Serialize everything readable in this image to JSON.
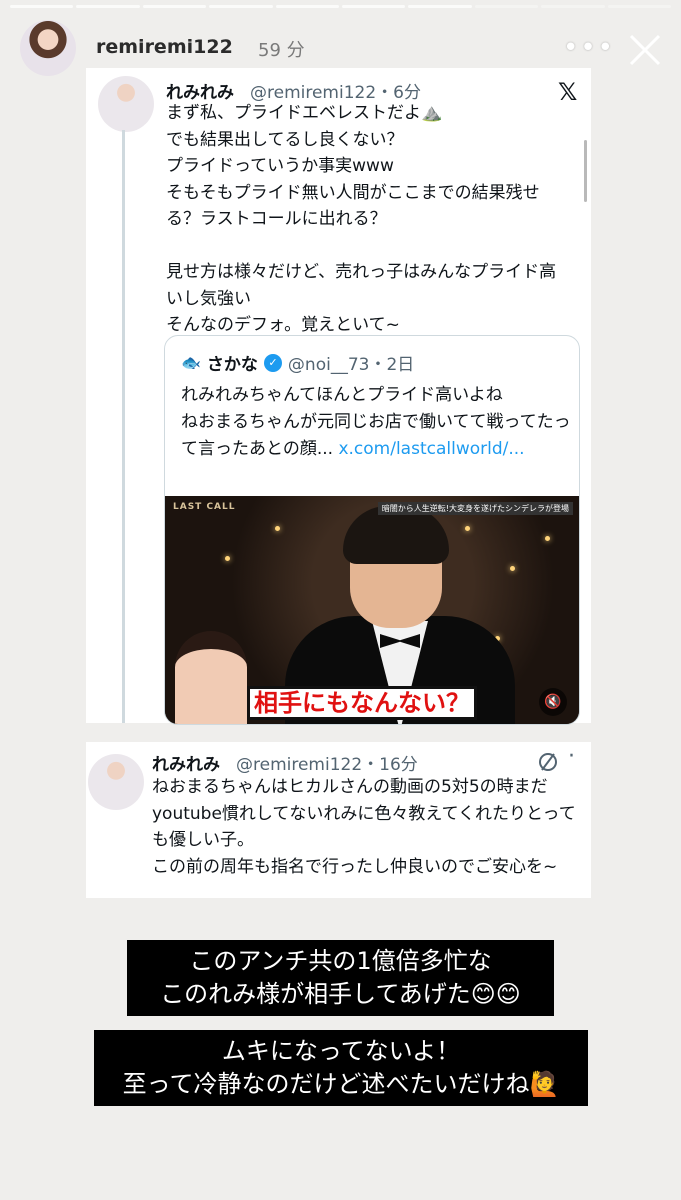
{
  "story": {
    "username": "remiremi122",
    "time": "59 分",
    "colors": {
      "background": "#efeeec",
      "link": "#1d9bf0"
    }
  },
  "tweet1": {
    "name": "れみれみ",
    "handle": "@remiremi122・6分",
    "body": "まず私、プライドエベレストだよ⛰️\nでも結果出してるし良くない？\nプライドっていうか事実www\nそもそもプライド無い人間がここまでの結果残せる？ラストコールに出れる？\n\n見せ方は様々だけど、売れっ子はみんなプライド高いし気強い\nそんなのデフォ。覚えといて~",
    "icon": "x-logo-icon"
  },
  "quote": {
    "name": "さかな",
    "handle": "@noi__73・2日",
    "text": "れみれみちゃんてほんとプライド高いよね\nねおまるちゃんが元同じお店で働いてて戦ってたって言ったあとの顔... ",
    "link": "x.com/lastcallworld/...",
    "media_caption": "相手にもなんない？",
    "media_logo": "LAST CALL",
    "media_chyron": "暗闇から人生逆転!大変身を遂げたシンデレラが登場"
  },
  "tweet2": {
    "name": "れみれみ",
    "handle": "@remiremi122・16分",
    "body": "ねおまるちゃんはヒカルさんの動画の5対5の時まだyoutube慣れしてないれみに色々教えてくれたりとっても優しい子。\nこの前の周年も指名で行ったし仲良いのでご安心を~"
  },
  "banners": [
    "このアンチ共の1億倍多忙な\nこのれみ様が相手してあげた😊😊",
    "ムキになってないよ！\n至って冷静なのだけど述べたいだけね🙋"
  ]
}
